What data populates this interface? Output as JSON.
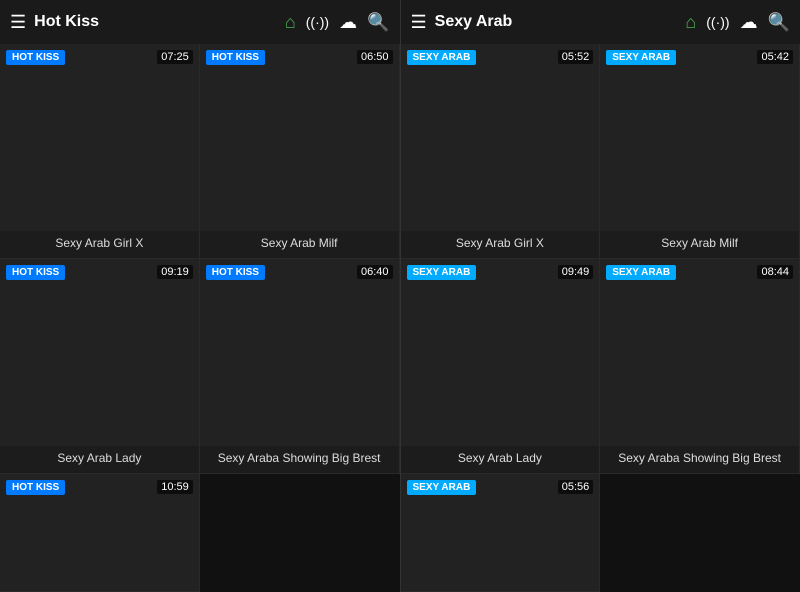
{
  "panels": [
    {
      "id": "hot-kiss",
      "header": {
        "title": "Hot Kiss",
        "badge_label": "HOT KISS",
        "badge_class": "badge-hotkiss"
      },
      "cards": [
        {
          "badge": "HOT KISS",
          "badge_class": "badge-hotkiss",
          "duration": "07:25",
          "title": "Sexy Arab Girl X"
        },
        {
          "badge": "HOT KISS",
          "badge_class": "badge-hotkiss",
          "duration": "06:50",
          "title": "Sexy Arab Milf"
        },
        {
          "badge": "HOT KISS",
          "badge_class": "badge-hotkiss",
          "duration": "09:19",
          "title": "Sexy Arab Lady"
        },
        {
          "badge": "HOT KISS",
          "badge_class": "badge-hotkiss",
          "duration": "06:40",
          "title": "Sexy Araba Showing Big Brest"
        },
        {
          "badge": "HOT KISS",
          "badge_class": "badge-hotkiss",
          "duration": "10:59",
          "title": "",
          "partial": true
        }
      ]
    },
    {
      "id": "sexy-arab",
      "header": {
        "title": "Sexy Arab",
        "badge_label": "SEXY ARAB",
        "badge_class": "badge-sexyarab"
      },
      "cards": [
        {
          "badge": "SEXY ARAB",
          "badge_class": "badge-sexyarab",
          "duration": "05:52",
          "title": "Sexy Arab Girl X"
        },
        {
          "badge": "SEXY ARAB",
          "badge_class": "badge-sexyarab",
          "duration": "05:42",
          "title": "Sexy Arab Milf"
        },
        {
          "badge": "SEXY ARAB",
          "badge_class": "badge-sexyarab",
          "duration": "09:49",
          "title": "Sexy Arab Lady"
        },
        {
          "badge": "SEXY ARAB",
          "badge_class": "badge-sexyarab",
          "duration": "08:44",
          "title": "Sexy Araba Showing Big Brest"
        },
        {
          "badge": "SEXY ARAB",
          "badge_class": "badge-sexyarab",
          "duration": "05:56",
          "title": "",
          "partial": true
        }
      ]
    }
  ],
  "nav_icons": {
    "home": "🏠",
    "signal": "((·))",
    "cloud": "☁",
    "search": "🔍",
    "menu": "☰"
  }
}
